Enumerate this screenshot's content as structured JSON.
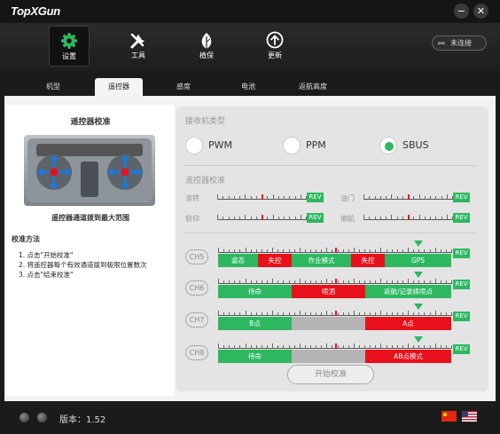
{
  "app": {
    "logo": "TopXGun",
    "minimize": "−",
    "close": "✕"
  },
  "toolbar": {
    "items": [
      {
        "label": "设置",
        "icon": "gear-icon",
        "active": true
      },
      {
        "label": "工具",
        "icon": "wrench-screwdriver-icon",
        "active": false
      },
      {
        "label": "植保",
        "icon": "leaf-icon",
        "active": false
      },
      {
        "label": "更新",
        "icon": "upload-circle-icon",
        "active": false
      }
    ],
    "connection": {
      "label": "未连接",
      "icon": "link-icon"
    }
  },
  "tabs": [
    {
      "label": "机型",
      "active": false
    },
    {
      "label": "遥控器",
      "active": true
    },
    {
      "label": "感度",
      "active": false
    },
    {
      "label": "电池",
      "active": false
    },
    {
      "label": "返航高度",
      "active": false
    }
  ],
  "left": {
    "title": "遥控器校准",
    "stick_caption": "遥控器通道拨到最大范围",
    "method_title": "校准方法",
    "steps": [
      "1. 点击\"开始校准\"",
      "2. 将遥控器每个有效通道拨到极限位置数次",
      "3. 点击\"结束校准\""
    ]
  },
  "receiver": {
    "title": "接收机类型",
    "options": [
      "PWM",
      "PPM",
      "SBUS"
    ],
    "selected": "SBUS"
  },
  "calibration": {
    "title": "遥控器校准",
    "axes": [
      {
        "label": "滚转",
        "rev": "REV"
      },
      {
        "label": "油门",
        "rev": "REV"
      },
      {
        "label": "俯仰",
        "rev": "REV"
      },
      {
        "label": "偏航",
        "rev": "REV"
      }
    ]
  },
  "channels": [
    {
      "name": "CH5",
      "rev": "REV",
      "segments": [
        {
          "label": "姿态",
          "color": "#2db860"
        },
        {
          "label": "失控",
          "color": "#e8101a"
        },
        {
          "label": "作业模式",
          "color": "#2db860"
        },
        {
          "label": "失控",
          "color": "#e8101a"
        },
        {
          "label": "GPS",
          "color": "#2db860"
        }
      ],
      "marker": 0.86
    },
    {
      "name": "CH6",
      "rev": "REV",
      "segments": [
        {
          "label": "待命",
          "color": "#2db860"
        },
        {
          "label": "喷洒",
          "color": "#e8101a"
        },
        {
          "label": "返航/记录续喷点",
          "color": "#2db860"
        }
      ],
      "marker": 0.86
    },
    {
      "name": "CH7",
      "rev": "REV",
      "segments": [
        {
          "label": "B点",
          "color": "#2db860"
        },
        {
          "label": "",
          "color": "#b4b4b4"
        },
        {
          "label": "A点",
          "color": "#e8101a"
        }
      ],
      "marker": 0.86
    },
    {
      "name": "CH8",
      "rev": "REV",
      "segments": [
        {
          "label": "待命",
          "color": "#2db860"
        },
        {
          "label": "",
          "color": "#b4b4b4"
        },
        {
          "label": "AB点模式",
          "color": "#e8101a"
        }
      ],
      "marker": 0.86
    }
  ],
  "start_button": "开始校准",
  "status": {
    "version": "版本：1.52",
    "languages": [
      "cn-flag-icon",
      "us-flag-icon"
    ]
  },
  "colors": {
    "accent": "#2db860",
    "alert": "#e8101a",
    "inactive": "#b4b4b4"
  }
}
